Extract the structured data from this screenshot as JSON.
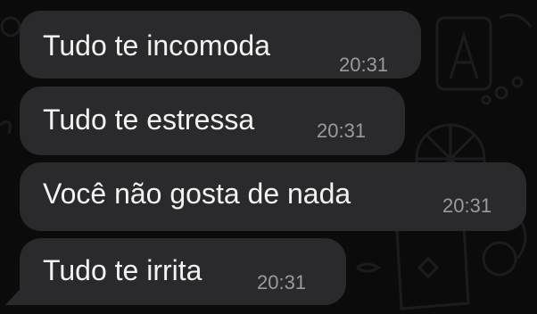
{
  "chat": {
    "messages": [
      {
        "text": "Tudo te incomoda",
        "time": "20:31"
      },
      {
        "text": "Tudo te estressa",
        "time": "20:31"
      },
      {
        "text": "Você não gosta de nada",
        "time": "20:31"
      },
      {
        "text": "Tudo te irrita",
        "time": "20:31"
      }
    ]
  },
  "colors": {
    "background": "#0b0b0c",
    "bubble": "#2a2a2c",
    "message_text": "#f2f2f2",
    "timestamp": "#9a9a9c"
  }
}
